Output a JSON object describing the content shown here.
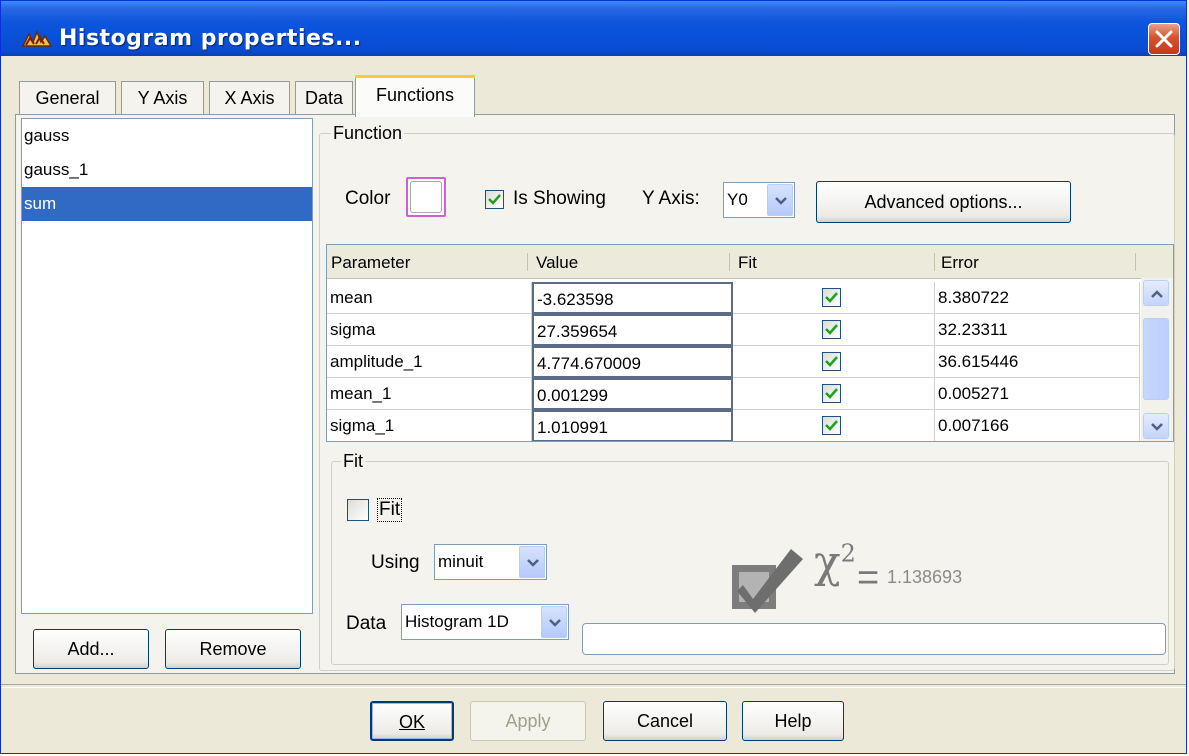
{
  "window": {
    "title": "Histogram properties..."
  },
  "tabs": [
    "General",
    "Y Axis",
    "X Axis",
    "Data",
    "Functions"
  ],
  "functions_list": [
    "gauss",
    "gauss_1",
    "sum"
  ],
  "list_buttons": {
    "add": "Add...",
    "remove": "Remove"
  },
  "function_group": {
    "legend": "Function",
    "color_label": "Color",
    "is_showing_label": "Is Showing",
    "is_showing_checked": true,
    "y_axis_label": "Y Axis:",
    "y_axis_value": "Y0",
    "advanced_button": "Advanced options..."
  },
  "table": {
    "headers": [
      "Parameter",
      "Value",
      "Fit",
      "Error"
    ],
    "rows": [
      {
        "param": "mean",
        "value": "-3.623598",
        "fit": true,
        "error": "8.380722"
      },
      {
        "param": "sigma",
        "value": "27.359654",
        "fit": true,
        "error": "32.23311"
      },
      {
        "param": "amplitude_1",
        "value": "4.774.670009",
        "fit": true,
        "error": "36.615446"
      },
      {
        "param": "mean_1",
        "value": "0.001299",
        "fit": true,
        "error": "0.005271"
      },
      {
        "param": "sigma_1",
        "value": "1.010991",
        "fit": true,
        "error": "0.007166"
      }
    ]
  },
  "fit_group": {
    "legend": "Fit",
    "fit_checkbox_label": "Fit",
    "fit_checked": false,
    "using_label": "Using",
    "using_value": "minuit",
    "data_label": "Data",
    "data_value": "Histogram 1D",
    "chi_symbol": "χ",
    "chi_exponent": "2",
    "chi_equals": "=",
    "chi_value": "1.138693"
  },
  "footer": {
    "ok": "OK",
    "apply": "Apply",
    "cancel": "Cancel",
    "help": "Help"
  },
  "colors": {
    "title_bar": "#0a4bd0",
    "selection": "#316ac5",
    "panel": "#ece9d8"
  }
}
